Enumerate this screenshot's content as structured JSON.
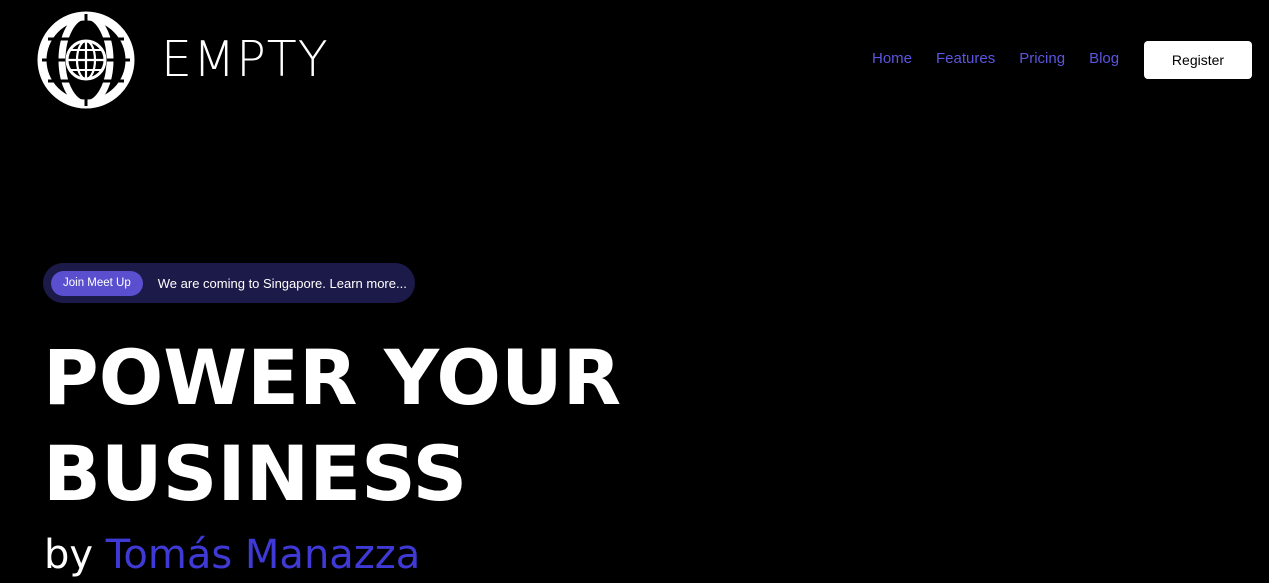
{
  "header": {
    "brand_name": "EMPTY",
    "logo_icon": "globe-icon",
    "nav": [
      {
        "label": "Home"
      },
      {
        "label": "Features"
      },
      {
        "label": "Pricing"
      },
      {
        "label": "Blog"
      }
    ],
    "register_label": "Register"
  },
  "announcement": {
    "badge_label": "Join Meet Up",
    "text": "We are coming to Singapore. Learn more..."
  },
  "hero": {
    "title_line1": "POWER YOUR",
    "title_line2": "BUSINESS",
    "by_prefix": "by",
    "author": "Tomás Manazza"
  },
  "colors": {
    "background": "#000000",
    "nav_link": "#5b55e0",
    "pill_background": "#1c1a48",
    "badge_background": "#5a4fcf",
    "author_accent": "#3f3ad6"
  }
}
